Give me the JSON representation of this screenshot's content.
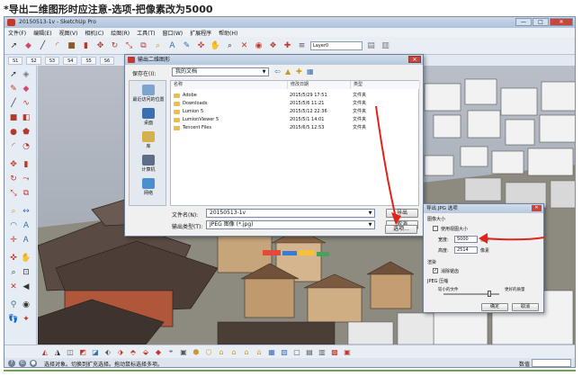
{
  "caption": "*导出二维图形时应注意-选项-把像素改为5000",
  "window": {
    "title": "20150513-1v - SketchUp Pro",
    "buttons": [
      "—",
      "□",
      "✕"
    ]
  },
  "menu": [
    "文件(F)",
    "编辑(E)",
    "视图(V)",
    "相机(C)",
    "绘图(R)",
    "工具(T)",
    "窗口(W)",
    "扩展程序",
    "帮助(H)"
  ],
  "layer_box": "Layer0",
  "style_tabs": [
    "S1",
    "S2",
    "S3",
    "S4",
    "S5",
    "S6"
  ],
  "export_dialog": {
    "title": "输出二维图形",
    "save_in_label": "保存在(I):",
    "save_in_value": "我的文档",
    "places": [
      "最近访问的位置",
      "桌面",
      "库",
      "计算机",
      "网络"
    ],
    "columns": [
      "名称",
      "修改日期",
      "类型"
    ],
    "files": [
      {
        "name": "Adobe",
        "date": "2015/5/29 17:51",
        "type": "文件夹"
      },
      {
        "name": "Downloads",
        "date": "2015/5/6 11:21",
        "type": "文件夹"
      },
      {
        "name": "Lumion 5",
        "date": "2015/5/12 22:36",
        "type": "文件夹"
      },
      {
        "name": "LumionViewer 5",
        "date": "2015/5/1 14:01",
        "type": "文件夹"
      },
      {
        "name": "Tencent Files",
        "date": "2015/6/5 12:53",
        "type": "文件夹"
      }
    ],
    "filename_label": "文件名(N):",
    "filename_value": "20150513-1v",
    "filetype_label": "输出类型(T):",
    "filetype_value": "JPEG 图像 (*.jpg)",
    "export_button": "导出",
    "cancel_button": "取消",
    "options_button": "选项..."
  },
  "jpg_options": {
    "title": "导出 JPG 选项",
    "image_size_label": "图像大小",
    "use_view_size_label": "使用视图大小",
    "use_view_size_checked": false,
    "width_label": "宽度:",
    "width_value": "5000",
    "height_label": "高度:",
    "height_value": "2514",
    "unit_label": "像素",
    "render_label": "渲染",
    "antialias_label": "消除锯齿",
    "antialias_checked": true,
    "compression_label": "JPEG 压缩",
    "smaller_label": "较小的文件",
    "better_label": "更好的质量",
    "compression_level": 0.85,
    "ok_button": "确定",
    "cancel_button": "取消"
  },
  "status": {
    "text": "选择对象。切换到扩充选择。拖动鼠标选择多项。",
    "measure_label": "数值"
  },
  "colors": {
    "arrow": "#e0241b",
    "folder": "#e8c04e"
  }
}
